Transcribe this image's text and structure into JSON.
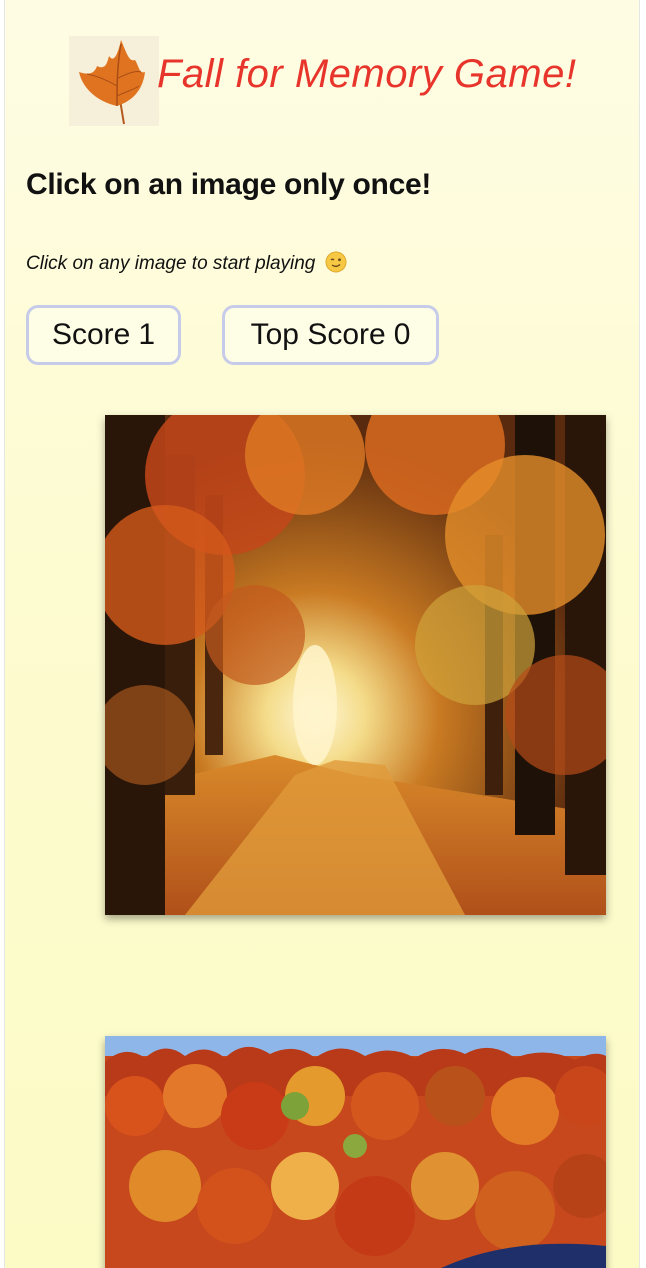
{
  "header": {
    "logo_icon": "autumn-leaf-icon",
    "title": "Fall for Memory Game!"
  },
  "headline": "Click on an image only once!",
  "instruction": {
    "text": "Click on any image to start playing",
    "emoji_icon": "winking-face-icon"
  },
  "scoreboard": {
    "score_label": "Score",
    "score_value": "1",
    "top_score_label": "Top Score",
    "top_score_value": "0"
  },
  "images": [
    {
      "icon": "autumn-forest-path-image"
    },
    {
      "icon": "autumn-treeline-image"
    }
  ],
  "colors": {
    "title": "#e8352c",
    "background": "#fdfbd0",
    "pill_border": "#c7cbea"
  }
}
